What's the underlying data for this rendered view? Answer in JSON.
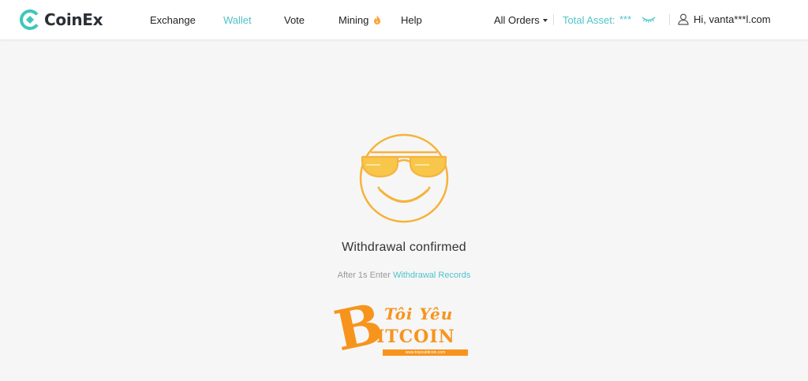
{
  "brand": {
    "name": "CoinEx",
    "accent_color": "#4fc3c9",
    "logo_icon": "coinex-logo-icon"
  },
  "nav": {
    "items": [
      {
        "label": "Exchange",
        "active": false
      },
      {
        "label": "Wallet",
        "active": true
      },
      {
        "label": "Vote",
        "active": false
      },
      {
        "label": "Mining",
        "active": false,
        "icon": "fire-icon"
      },
      {
        "label": "Help",
        "active": false
      }
    ]
  },
  "header": {
    "orders_label": "All Orders",
    "asset_label": "Total Asset:",
    "asset_value": "***",
    "eye_icon": "eye-closed-icon",
    "user_icon": "user-icon",
    "greeting": "Hi, vanta***l.com"
  },
  "main": {
    "illustration": "sunglasses-smiley-icon",
    "title": "Withdrawal confirmed",
    "hint_prefix": "After 1s Enter ",
    "hint_link": "Withdrawal Records"
  },
  "watermark": {
    "line1": "Tôi Yêu",
    "line2": "ITCOIN",
    "letter": "B",
    "url": "www.toiyeubitcoin.com",
    "color": "#f7941d"
  }
}
